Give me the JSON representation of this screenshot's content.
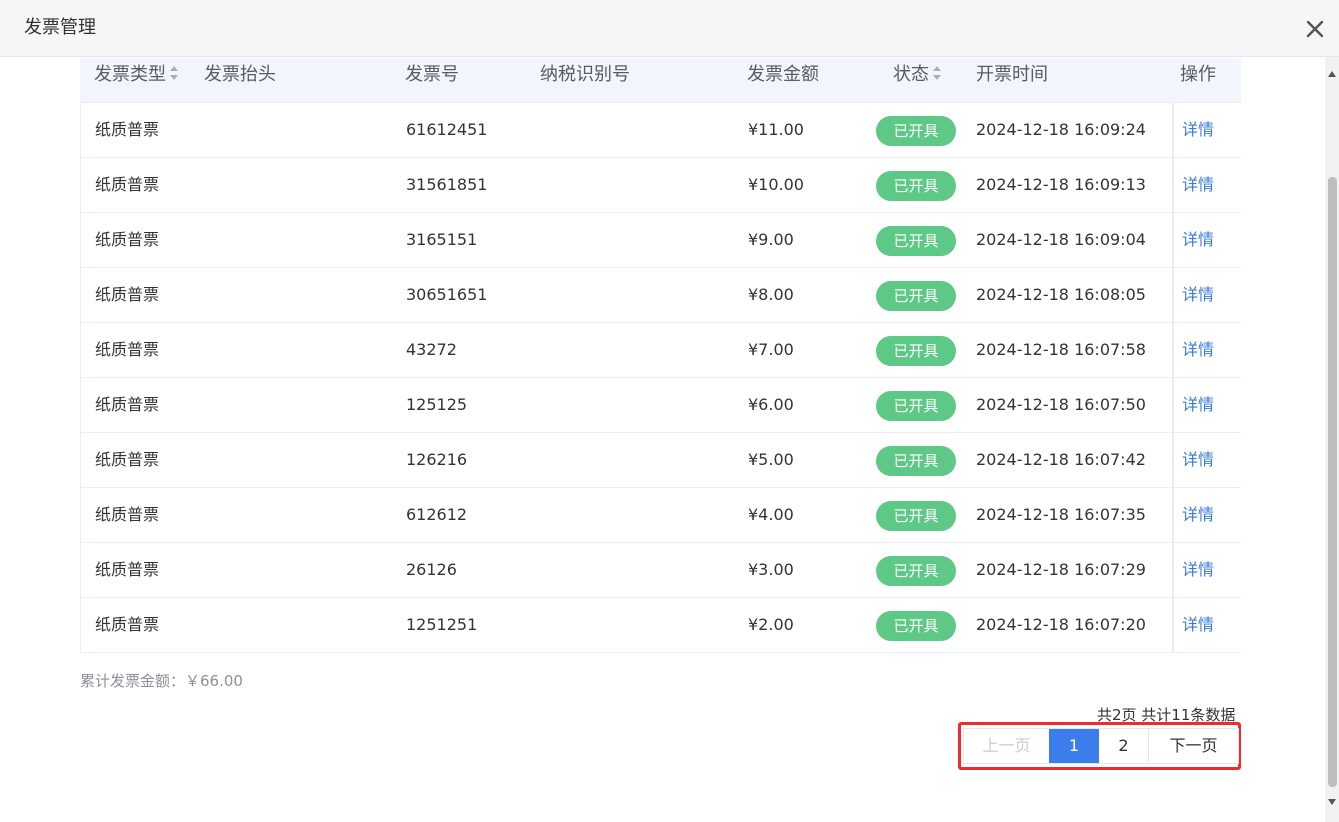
{
  "dialog": {
    "title": "发票管理"
  },
  "table": {
    "headers": {
      "type": "发票类型",
      "title": "发票抬头",
      "number": "发票号",
      "tax_id": "纳税识别号",
      "amount": "发票金额",
      "status": "状态",
      "time": "开票时间",
      "action": "操作"
    },
    "rows": [
      {
        "type": "纸质普票",
        "title": "",
        "number": "61612451",
        "tax_id": "",
        "amount": "¥11.00",
        "status": "已开具",
        "time": "2024-12-18 16:09:24",
        "action": "详情"
      },
      {
        "type": "纸质普票",
        "title": "",
        "number": "31561851",
        "tax_id": "",
        "amount": "¥10.00",
        "status": "已开具",
        "time": "2024-12-18 16:09:13",
        "action": "详情"
      },
      {
        "type": "纸质普票",
        "title": "",
        "number": "3165151",
        "tax_id": "",
        "amount": "¥9.00",
        "status": "已开具",
        "time": "2024-12-18 16:09:04",
        "action": "详情"
      },
      {
        "type": "纸质普票",
        "title": "",
        "number": "30651651",
        "tax_id": "",
        "amount": "¥8.00",
        "status": "已开具",
        "time": "2024-12-18 16:08:05",
        "action": "详情"
      },
      {
        "type": "纸质普票",
        "title": "",
        "number": "43272",
        "tax_id": "",
        "amount": "¥7.00",
        "status": "已开具",
        "time": "2024-12-18 16:07:58",
        "action": "详情"
      },
      {
        "type": "纸质普票",
        "title": "",
        "number": "125125",
        "tax_id": "",
        "amount": "¥6.00",
        "status": "已开具",
        "time": "2024-12-18 16:07:50",
        "action": "详情"
      },
      {
        "type": "纸质普票",
        "title": "",
        "number": "126216",
        "tax_id": "",
        "amount": "¥5.00",
        "status": "已开具",
        "time": "2024-12-18 16:07:42",
        "action": "详情"
      },
      {
        "type": "纸质普票",
        "title": "",
        "number": "612612",
        "tax_id": "",
        "amount": "¥4.00",
        "status": "已开具",
        "time": "2024-12-18 16:07:35",
        "action": "详情"
      },
      {
        "type": "纸质普票",
        "title": "",
        "number": "26126",
        "tax_id": "",
        "amount": "¥3.00",
        "status": "已开具",
        "time": "2024-12-18 16:07:29",
        "action": "详情"
      },
      {
        "type": "纸质普票",
        "title": "",
        "number": "1251251",
        "tax_id": "",
        "amount": "¥2.00",
        "status": "已开具",
        "time": "2024-12-18 16:07:20",
        "action": "详情"
      }
    ]
  },
  "summary": {
    "total_amount": "累计发票金额：￥66.00"
  },
  "pagination": {
    "summary": "共2页 共计11条数据",
    "prev": "上一页",
    "pages": [
      "1",
      "2"
    ],
    "current": "1",
    "next": "下一页"
  },
  "colors": {
    "status_badge": "#5ec886",
    "active_page": "#3b7dea",
    "link": "#3a7bd5",
    "highlight_box": "#ef2b2b"
  },
  "icons": {
    "close": "close-icon",
    "sort": "sort-icon"
  }
}
